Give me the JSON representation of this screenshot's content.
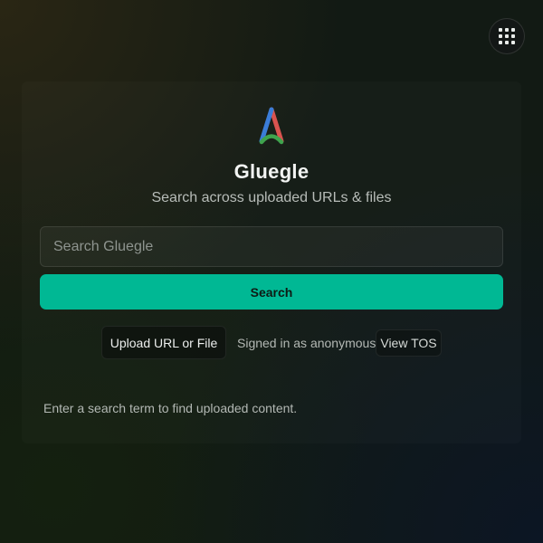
{
  "header": {
    "apps_icon": "grid-apps-icon"
  },
  "brand": {
    "logo_icon": "gluegle-a-logo-icon",
    "title": "Gluegle",
    "subtitle": "Search across uploaded URLs & files",
    "logo_colors": [
      "#d9534f",
      "#3b7dd8",
      "#3fa34d"
    ]
  },
  "search": {
    "value": "",
    "placeholder": "Search Gluegle",
    "button_label": "Search"
  },
  "actions": {
    "upload_label": "Upload URL or File",
    "signed_in_text": "Signed in as anonymous",
    "tos_label": "View TOS"
  },
  "results": {
    "hint": "Enter a search term to find uploaded content."
  },
  "colors": {
    "accent": "#00b894",
    "background": "#121a14"
  }
}
